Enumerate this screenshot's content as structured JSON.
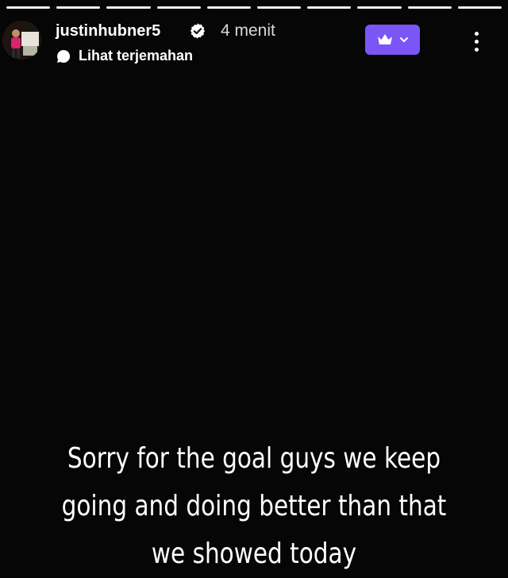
{
  "story": {
    "progress_segments": 10,
    "progress_active": 10,
    "user": {
      "username": "justinhubner5",
      "verified": true,
      "time_ago": "4 menit",
      "avatar_icon": "profile-photo"
    },
    "translate": {
      "icon": "speech-bubble-icon",
      "label": "Lihat terjemahan"
    },
    "premium_button": {
      "icon": "crown-icon",
      "dropdown_icon": "chevron-down-icon",
      "color": "#7b55f6"
    },
    "more_icon": "vertical-ellipsis-icon",
    "caption": "Sorry for the goal guys we keep going and doing better than that we showed today"
  }
}
